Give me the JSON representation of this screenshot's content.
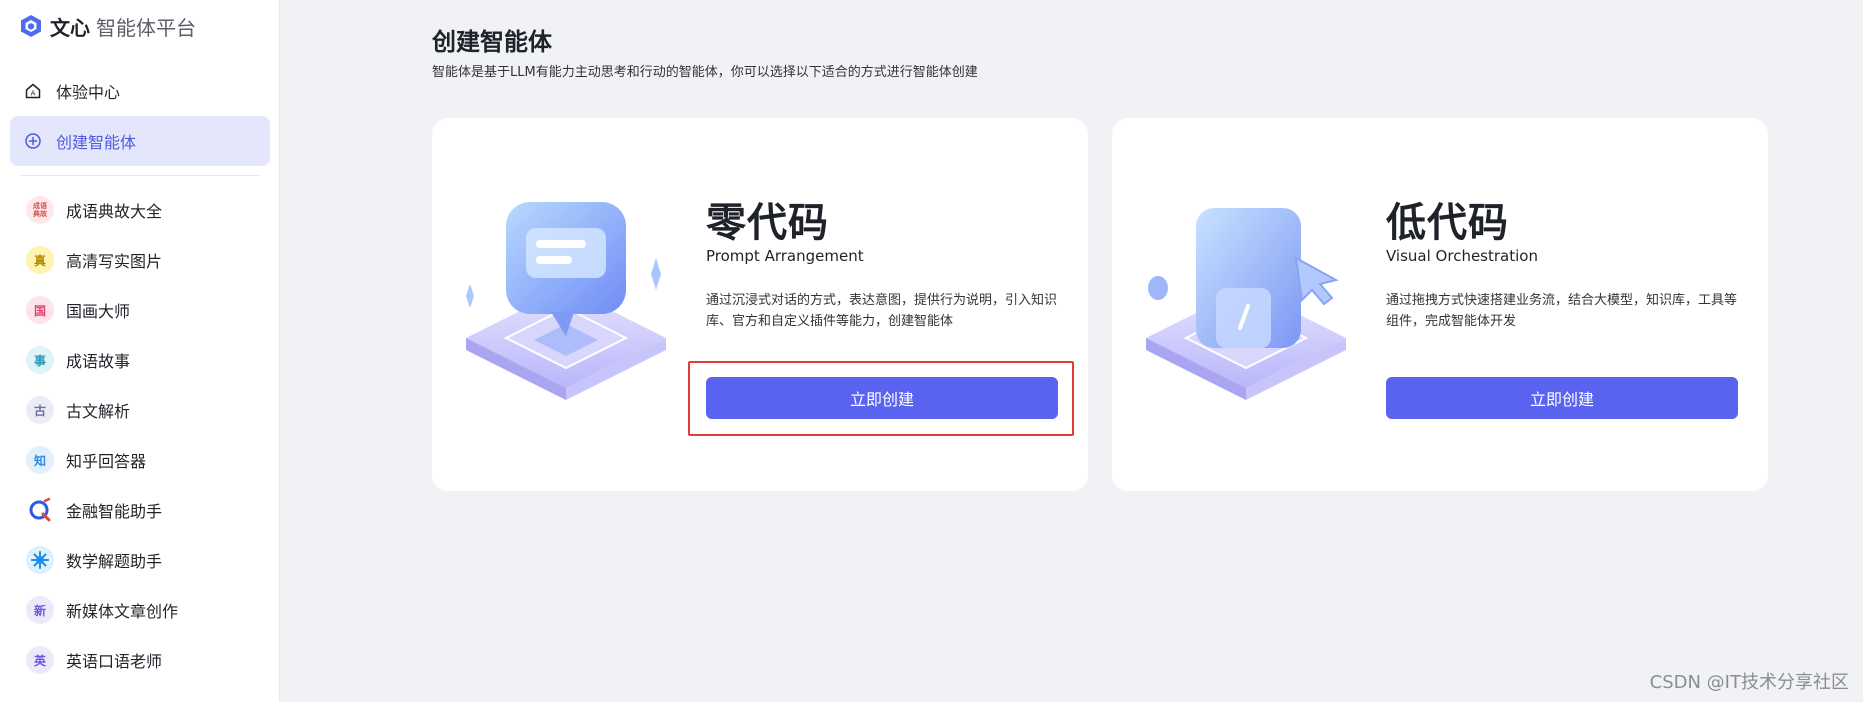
{
  "brand": {
    "strong": "文心",
    "rest": "智能体平台",
    "accent": "#4f6bf0"
  },
  "nav": {
    "items": [
      {
        "label": "体验中心",
        "icon": "home-icon"
      },
      {
        "label": "创建智能体",
        "icon": "plus-circle-icon",
        "active": true
      }
    ]
  },
  "agents": [
    {
      "label": "成语典故大全",
      "avatar_text": "成语典故",
      "bg": "#fde8ea",
      "fg": "#d9534f"
    },
    {
      "label": "高清写实图片",
      "avatar_text": "真",
      "bg": "#fff3b0",
      "fg": "#b38b00"
    },
    {
      "label": "国画大师",
      "avatar_text": "国",
      "bg": "#fde3ea",
      "fg": "#e0456b"
    },
    {
      "label": "成语故事",
      "avatar_text": "事",
      "bg": "#dff3f8",
      "fg": "#2b9ab8"
    },
    {
      "label": "古文解析",
      "avatar_text": "古",
      "bg": "#ececf7",
      "fg": "#6b6fa8"
    },
    {
      "label": "知乎回答器",
      "avatar_text": "知",
      "bg": "#e1f0fc",
      "fg": "#2d8ae0"
    },
    {
      "label": "金融智能助手",
      "avatar_text": "Q",
      "bg": "#ffffff",
      "fg": "#2d5be0"
    },
    {
      "label": "数学解题助手",
      "avatar_text": "✺",
      "bg": "#dff0fd",
      "fg": "#1f8fe8"
    },
    {
      "label": "新媒体文章创作",
      "avatar_text": "新",
      "bg": "#ece9fb",
      "fg": "#6a5ad9"
    },
    {
      "label": "英语口语老师",
      "avatar_text": "英",
      "bg": "#ece9fb",
      "fg": "#6a5ad9"
    }
  ],
  "main": {
    "title": "创建智能体",
    "description": "智能体是基于LLM有能力主动思考和行动的智能体，你可以选择以下适合的方式进行智能体创建"
  },
  "cards": [
    {
      "title": "零代码",
      "subtitle": "Prompt Arrangement",
      "description": "通过沉浸式对话的方式，表达意图，提供行为说明，引入知识库、官方和自定义插件等能力，创建智能体",
      "button": "立即创建",
      "icon": "chat-bubble-illustration"
    },
    {
      "title": "低代码",
      "subtitle": "Visual Orchestration",
      "description": "通过拖拽方式快速搭建业务流，结合大模型，知识库，工具等组件，完成智能体开发",
      "button": "立即创建",
      "icon": "drag-cursor-illustration"
    }
  ],
  "colors": {
    "primary": "#5a63f0",
    "highlight": "#e23b3b",
    "page_bg": "#f1f2f6"
  },
  "watermark": "CSDN @IT技术分享社区"
}
